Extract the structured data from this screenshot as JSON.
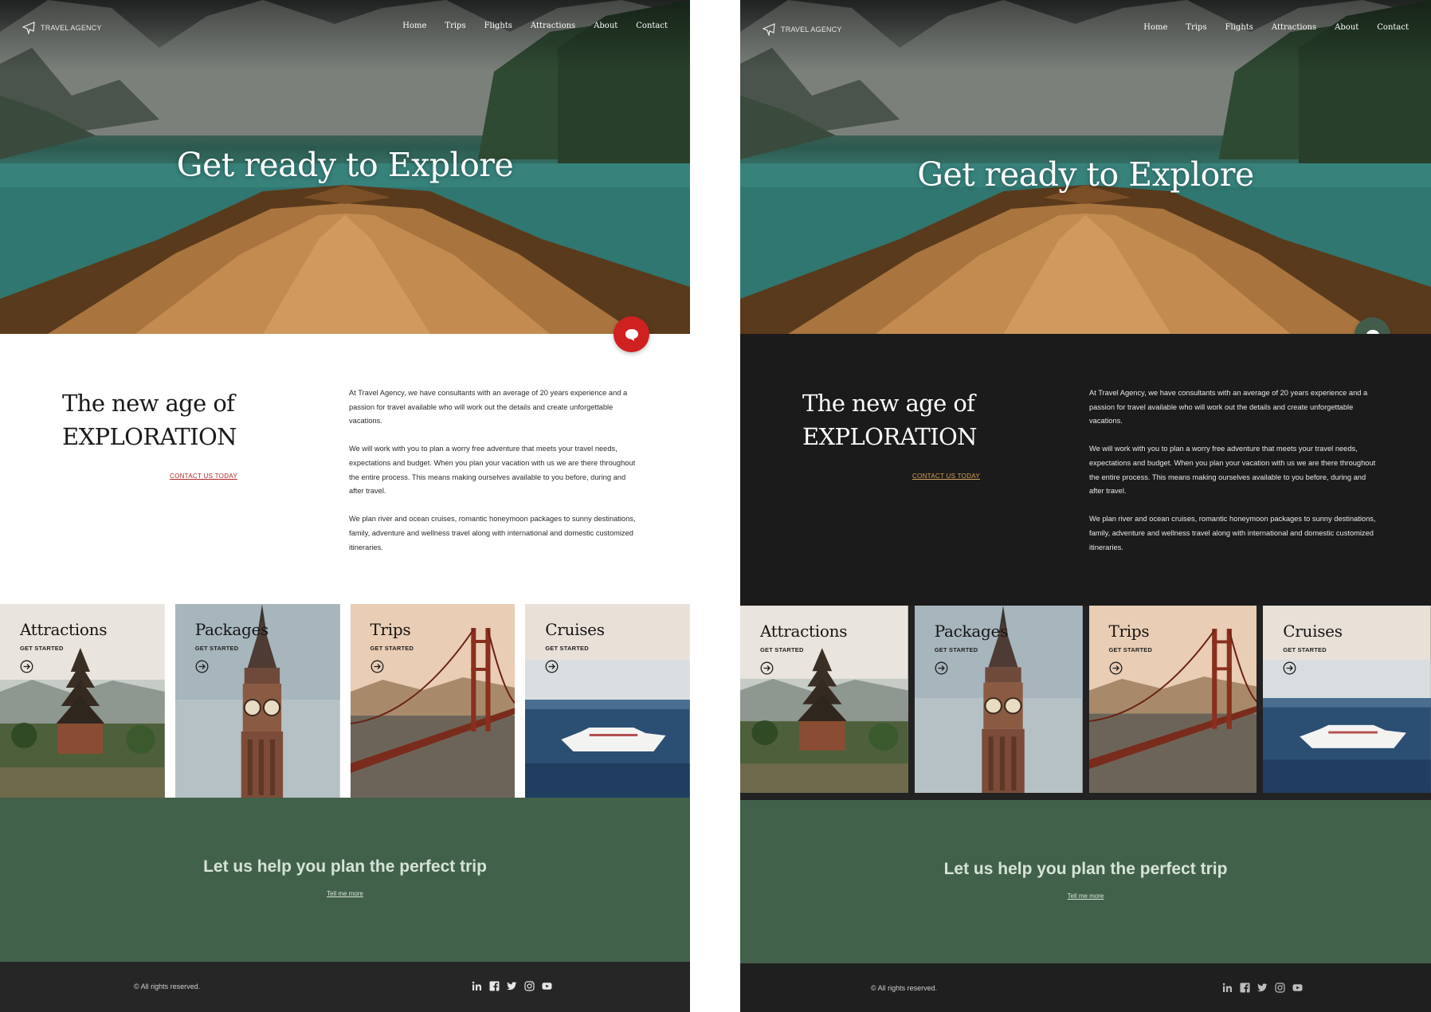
{
  "brand": {
    "name": "TRAVEL AGENCY"
  },
  "nav": [
    "Home",
    "Trips",
    "Flights",
    "Attractions",
    "About",
    "Contact"
  ],
  "hero": {
    "title": "Get ready to Explore"
  },
  "intro": {
    "heading_line1": "The new age of",
    "heading_line2": "EXPLORATION",
    "cta": "CONTACT US TODAY",
    "paragraphs": [
      "At Travel Agency, we have consultants with an average of 20 years experience and a passion for travel available who will work out the details and create unforgettable vacations.",
      "We will work with you to plan a worry free adventure that meets your travel needs, expectations and budget. When you plan your vacation with us we are there throughout the entire process.  This means making ourselves available to you before, during and after travel.",
      "We plan river and ocean cruises, romantic honeymoon packages to sunny destinations, family, adventure and wellness travel along with international and domestic customized itineraries."
    ]
  },
  "cards": [
    {
      "title": "Attractions",
      "sub": "GET STARTED"
    },
    {
      "title": "Packages",
      "sub": "GET STARTED"
    },
    {
      "title": "Trips",
      "sub": "GET STARTED"
    },
    {
      "title": "Cruises",
      "sub": "GET STARTED"
    }
  ],
  "cta": {
    "title": "Let us help you plan the perfect trip",
    "link": "Tell me more"
  },
  "footer": {
    "copyright": "© All rights reserved.",
    "socials": [
      "linkedin-icon",
      "facebook-icon",
      "twitter-icon",
      "instagram-icon",
      "youtube-icon"
    ]
  },
  "colors": {
    "light_bg": "#ffffff",
    "dark_bg": "#1b1b1b",
    "green_band": "#42614b",
    "light_chat": "#d02121",
    "dark_chat": "#425b4b",
    "light_link": "#b02727",
    "dark_link": "#d4a25a"
  }
}
